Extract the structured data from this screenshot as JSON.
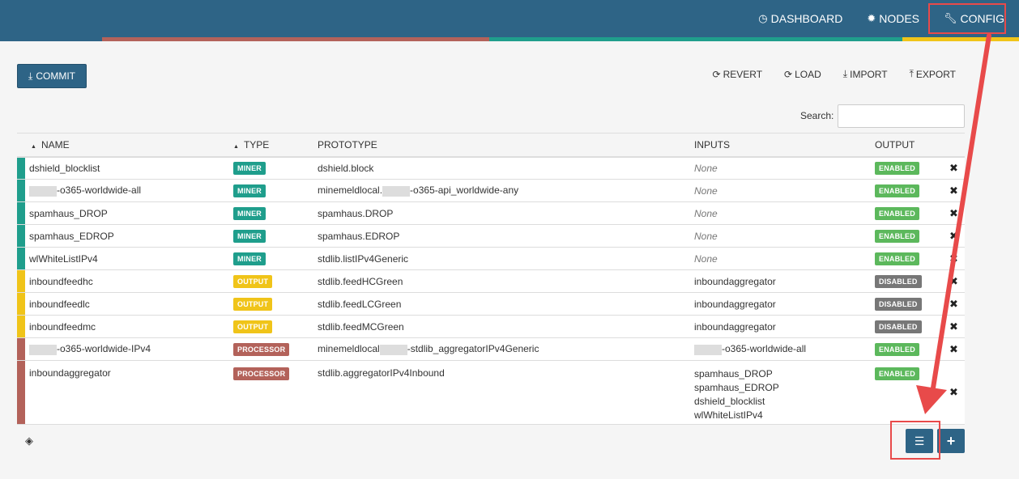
{
  "nav": {
    "dashboard": "DASHBOARD",
    "nodes": "NODES",
    "config": "CONFIG"
  },
  "toolbar": {
    "commit": "COMMIT",
    "revert": "REVERT",
    "load": "LOAD",
    "import": "IMPORT",
    "export": "EXPORT"
  },
  "search": {
    "label": "Search:",
    "value": ""
  },
  "table": {
    "headers": {
      "name": "NAME",
      "type": "TYPE",
      "prototype": "PROTOTYPE",
      "inputs": "INPUTS",
      "output": "OUTPUT"
    },
    "rows": [
      {
        "name": "dshield_blocklist",
        "type": "MINER",
        "prototype": "dshield.block",
        "inputs": "None",
        "output": "ENABLED"
      },
      {
        "name": "-o365-worldwide-all",
        "type": "MINER",
        "prototype_pre": "minemeldlocal.",
        "prototype": "-o365-api_worldwide-any",
        "inputs": "None",
        "output": "ENABLED"
      },
      {
        "name": "spamhaus_DROP",
        "type": "MINER",
        "prototype": "spamhaus.DROP",
        "inputs": "None",
        "output": "ENABLED"
      },
      {
        "name": "spamhaus_EDROP",
        "type": "MINER",
        "prototype": "spamhaus.EDROP",
        "inputs": "None",
        "output": "ENABLED"
      },
      {
        "name": "wlWhiteListIPv4",
        "type": "MINER",
        "prototype": "stdlib.listIPv4Generic",
        "inputs": "None",
        "output": "ENABLED"
      },
      {
        "name": "inboundfeedhc",
        "type": "OUTPUT",
        "prototype": "stdlib.feedHCGreen",
        "inputs": "inboundaggregator",
        "output": "DISABLED"
      },
      {
        "name": "inboundfeedlc",
        "type": "OUTPUT",
        "prototype": "stdlib.feedLCGreen",
        "inputs": "inboundaggregator",
        "output": "DISABLED"
      },
      {
        "name": "inboundfeedmc",
        "type": "OUTPUT",
        "prototype": "stdlib.feedMCGreen",
        "inputs": "inboundaggregator",
        "output": "DISABLED"
      },
      {
        "name": "-o365-worldwide-IPv4",
        "type": "PROCESSOR",
        "prototype_pre": "minemeldlocal",
        "prototype": "-stdlib_aggregatorIPv4Generic",
        "inputs": "-o365-worldwide-all",
        "output": "ENABLED"
      },
      {
        "name": "inboundaggregator",
        "type": "PROCESSOR",
        "prototype": "stdlib.aggregatorIPv4Inbound",
        "inputs_list": [
          "spamhaus_DROP",
          "spamhaus_EDROP",
          "dshield_blocklist",
          "wlWhiteListIPv4"
        ],
        "output": "ENABLED"
      }
    ]
  },
  "colors": {
    "header": "#2e6486",
    "miner": "#1f9e8c",
    "output": "#f0c419",
    "processor": "#b3625a",
    "enabled": "#5cb85c",
    "disabled": "#777777",
    "highlight": "#e84a4a"
  },
  "icons": {
    "dashboard": "dashboard-icon",
    "nodes": "nodes-icon",
    "config": "wrench-icon",
    "commit": "download-icon",
    "revert": "refresh-icon",
    "load": "refresh-icon",
    "import": "import-icon",
    "export": "export-icon",
    "remove": "close-icon",
    "hidden": "eye-slash-icon",
    "list": "list-icon",
    "add": "plus-icon"
  }
}
